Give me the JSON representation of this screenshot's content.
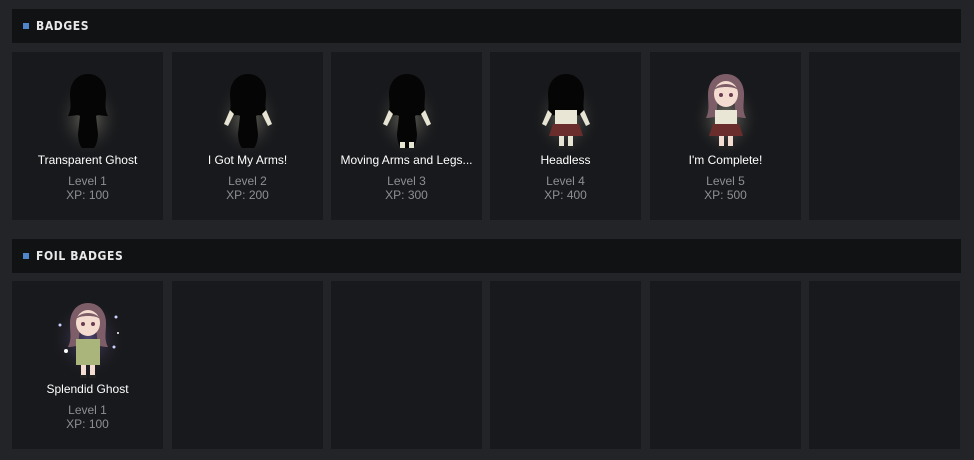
{
  "sections": [
    {
      "title": "BADGES",
      "badges": [
        {
          "name": "Transparent Ghost",
          "level": "Level 1",
          "xp": "XP: 100",
          "art": "silhouette-ghost"
        },
        {
          "name": "I Got My Arms!",
          "level": "Level 2",
          "xp": "XP: 200",
          "art": "silhouette-arms"
        },
        {
          "name": "Moving Arms and Legs...",
          "level": "Level 3",
          "xp": "XP: 300",
          "art": "silhouette-legs"
        },
        {
          "name": "Headless",
          "level": "Level 4",
          "xp": "XP: 400",
          "art": "headless-girl"
        },
        {
          "name": "I'm Complete!",
          "level": "Level 5",
          "xp": "XP: 500",
          "art": "complete-girl"
        }
      ]
    },
    {
      "title": "FOIL BADGES",
      "badges": [
        {
          "name": "Splendid Ghost",
          "level": "Level 1",
          "xp": "XP: 100",
          "art": "foil-girl"
        }
      ]
    }
  ],
  "colors": {
    "accent": "#4f86c9",
    "card_bg": "#18191c",
    "header_bg": "#111214",
    "page_bg": "#232428",
    "muted_text": "#8d8f94"
  }
}
